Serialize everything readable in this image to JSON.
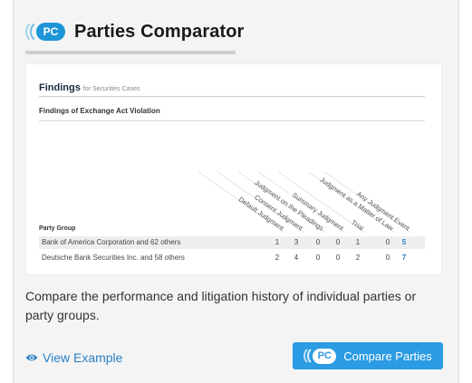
{
  "card": {
    "badge": "PC",
    "title": "Parties Comparator",
    "description": "Compare the performance and litigation history of individual parties or party groups.",
    "view_example": "View Example",
    "compare_button": "Compare Parties",
    "accent_color": "#1e95d6"
  },
  "preview": {
    "title": "Findings",
    "subtitle": "for Securities Cases",
    "heading": "Findings of Exchange Act Violation",
    "columns": [
      "Default Judgment",
      "Consent Judgment",
      "Judgment on the Pleadings",
      "Summary Judgment",
      "Trial",
      "Judgment as a Matter of Law",
      "Any Judgment Event"
    ],
    "party_group_label": "Party Group",
    "rows": [
      {
        "name": "Bank of America Corporation and 62 others",
        "values": [
          "1",
          "3",
          "0",
          "0",
          "1",
          "0",
          "5"
        ]
      },
      {
        "name": "Deutsche Bank Securities Inc. and 58 others",
        "values": [
          "2",
          "4",
          "0",
          "0",
          "2",
          "0",
          "7"
        ]
      }
    ]
  }
}
